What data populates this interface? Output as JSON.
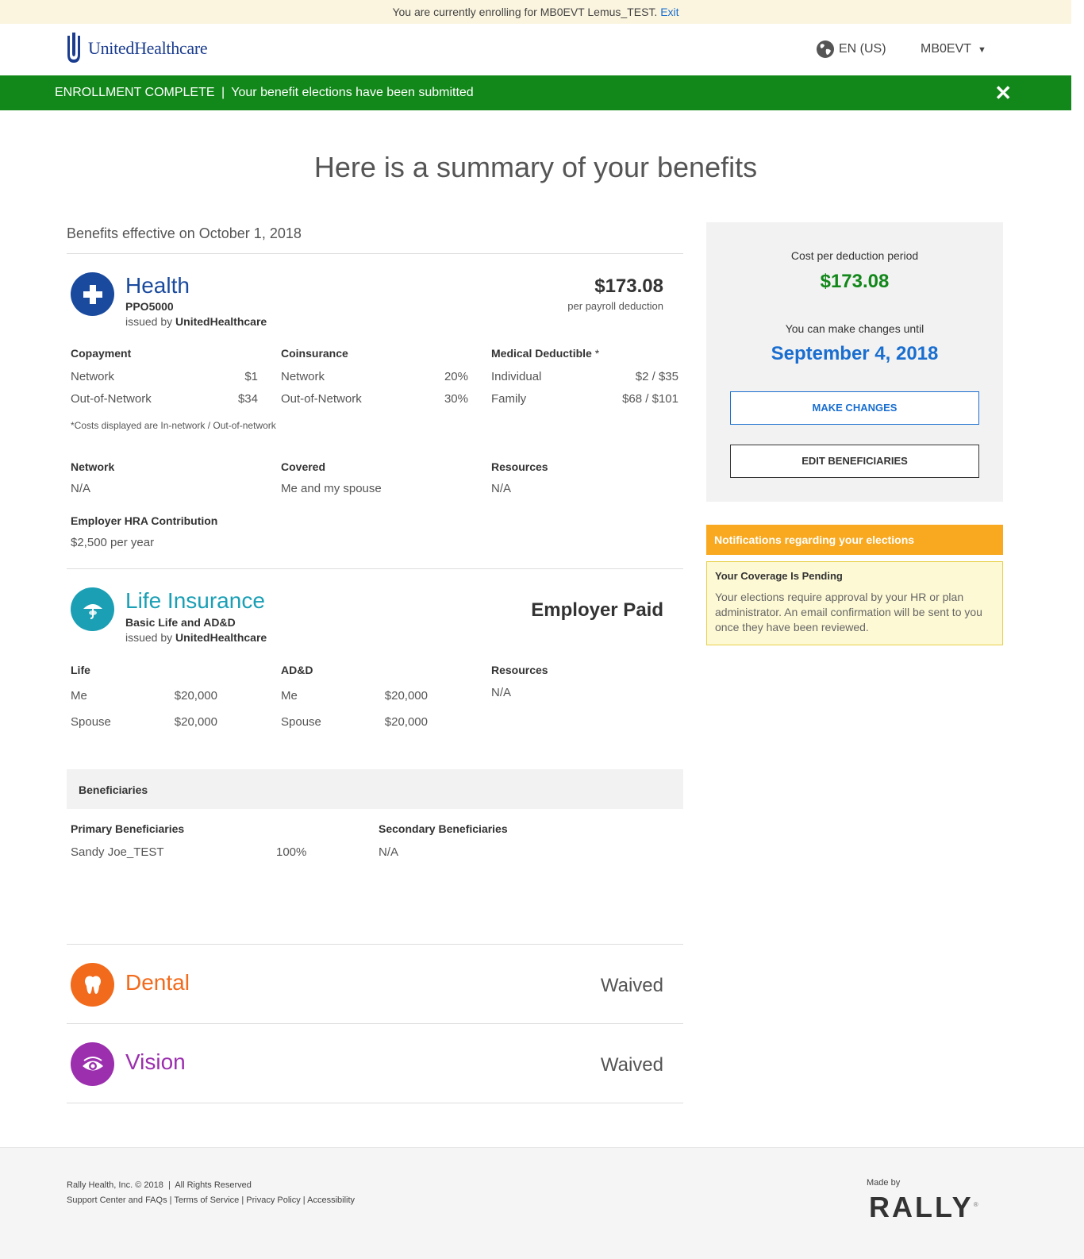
{
  "banner": {
    "text": "You are currently enrolling for MB0EVT Lemus_TEST.",
    "exit_label": "Exit"
  },
  "header": {
    "logo": "UnitedHealthcare",
    "language": "EN (US)",
    "user": "MB0EVT"
  },
  "alert": {
    "status": "ENROLLMENT COMPLETE",
    "separator": "|",
    "message": "Your benefit elections have been submitted"
  },
  "page_title": "Here is a summary of your benefits",
  "effective": "Benefits effective on October 1, 2018",
  "health": {
    "name": "Health",
    "plan": "PPO5000",
    "issued_prefix": "issued by",
    "issuer": "UnitedHealthcare",
    "price": "$173.08",
    "price_sub": "per payroll deduction",
    "copayment": {
      "label": "Copayment",
      "rows": [
        {
          "k": "Network",
          "v": "$1"
        },
        {
          "k": "Out-of-Network",
          "v": "$34"
        }
      ]
    },
    "coinsurance": {
      "label": "Coinsurance",
      "rows": [
        {
          "k": "Network",
          "v": "20%"
        },
        {
          "k": "Out-of-Network",
          "v": "30%"
        }
      ]
    },
    "deductible": {
      "label": "Medical Deductible",
      "asterisk": "*",
      "rows": [
        {
          "k": "Individual",
          "v": "$2 / $35"
        },
        {
          "k": "Family",
          "v": "$68 / $101"
        }
      ]
    },
    "note": "*Costs displayed are In-network / Out-of-network",
    "network_label": "Network",
    "network_value": "N/A",
    "covered_label": "Covered",
    "covered_value": "Me and my spouse",
    "resources_label": "Resources",
    "resources_value": "N/A",
    "hra_label": "Employer HRA Contribution",
    "hra_value": "$2,500 per year"
  },
  "life": {
    "name": "Life Insurance",
    "plan": "Basic Life and AD&D",
    "issued_prefix": "issued by",
    "issuer": "UnitedHealthcare",
    "price": "Employer Paid",
    "life_col": {
      "label": "Life",
      "rows": [
        {
          "k": "Me",
          "v": "$20,000"
        },
        {
          "k": "Spouse",
          "v": "$20,000"
        }
      ]
    },
    "add_col": {
      "label": "AD&D",
      "rows": [
        {
          "k": "Me",
          "v": "$20,000"
        },
        {
          "k": "Spouse",
          "v": "$20,000"
        }
      ]
    },
    "resources_label": "Resources",
    "resources_value": "N/A"
  },
  "beneficiaries": {
    "title": "Beneficiaries",
    "primary_label": "Primary Beneficiaries",
    "primary_name": "Sandy Joe_TEST",
    "primary_pct": "100%",
    "secondary_label": "Secondary Beneficiaries",
    "secondary_value": "N/A"
  },
  "dental": {
    "name": "Dental",
    "status": "Waived"
  },
  "vision": {
    "name": "Vision",
    "status": "Waived"
  },
  "sidebar": {
    "cost_label": "Cost per deduction period",
    "cost_value": "$173.08",
    "changes_label": "You can make changes until",
    "changes_date": "September 4, 2018",
    "make_changes": "MAKE CHANGES",
    "edit_beneficiaries": "EDIT BENEFICIARIES"
  },
  "notifications": {
    "header": "Notifications regarding your elections",
    "title": "Your Coverage Is Pending",
    "text": "Your elections require approval by your HR or plan administrator. An email confirmation will be sent to you once they have been reviewed."
  },
  "footer": {
    "copyright": "Rally Health, Inc. © 2018",
    "rights": "All Rights Reserved",
    "links": [
      "Support Center and FAQs",
      "Terms of Service",
      "Privacy Policy",
      "Accessibility"
    ],
    "made_by": "Made by",
    "brand": "RALLY"
  },
  "colors": {
    "green": "#12871a",
    "health": "#1a4a9e",
    "life": "#1a9fb5",
    "dental": "#f26a1b",
    "vision": "#9b2fae",
    "blue": "#196ecf",
    "orange": "#f8a91f"
  }
}
